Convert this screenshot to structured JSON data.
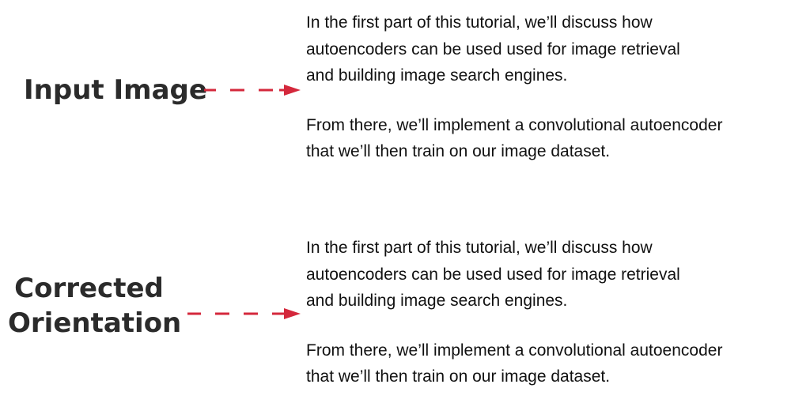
{
  "labels": {
    "input_image": "Input Image",
    "corrected_line1": "Corrected",
    "corrected_line2": "Orientation"
  },
  "colors": {
    "arrow": "#d4283c",
    "label_text": "#2b2b2b",
    "body_text": "#111111"
  },
  "input_document": {
    "paragraph1": [
      "In the first part of this tutorial, we’ll discuss how",
      "autoencoders can be used used for image retrieval",
      "and building image search engines."
    ],
    "paragraph2": [
      "From there, we’ll implement a convolutional autoencoder",
      "that we’ll then train on our image dataset."
    ]
  },
  "corrected_document": {
    "paragraph1": [
      "In the first part of this tutorial, we’ll discuss how",
      "autoencoders can be used used for image retrieval",
      "and building image search engines."
    ],
    "paragraph2": [
      "From there, we’ll implement a convolutional autoencoder",
      "that we’ll then train on our image dataset."
    ]
  }
}
